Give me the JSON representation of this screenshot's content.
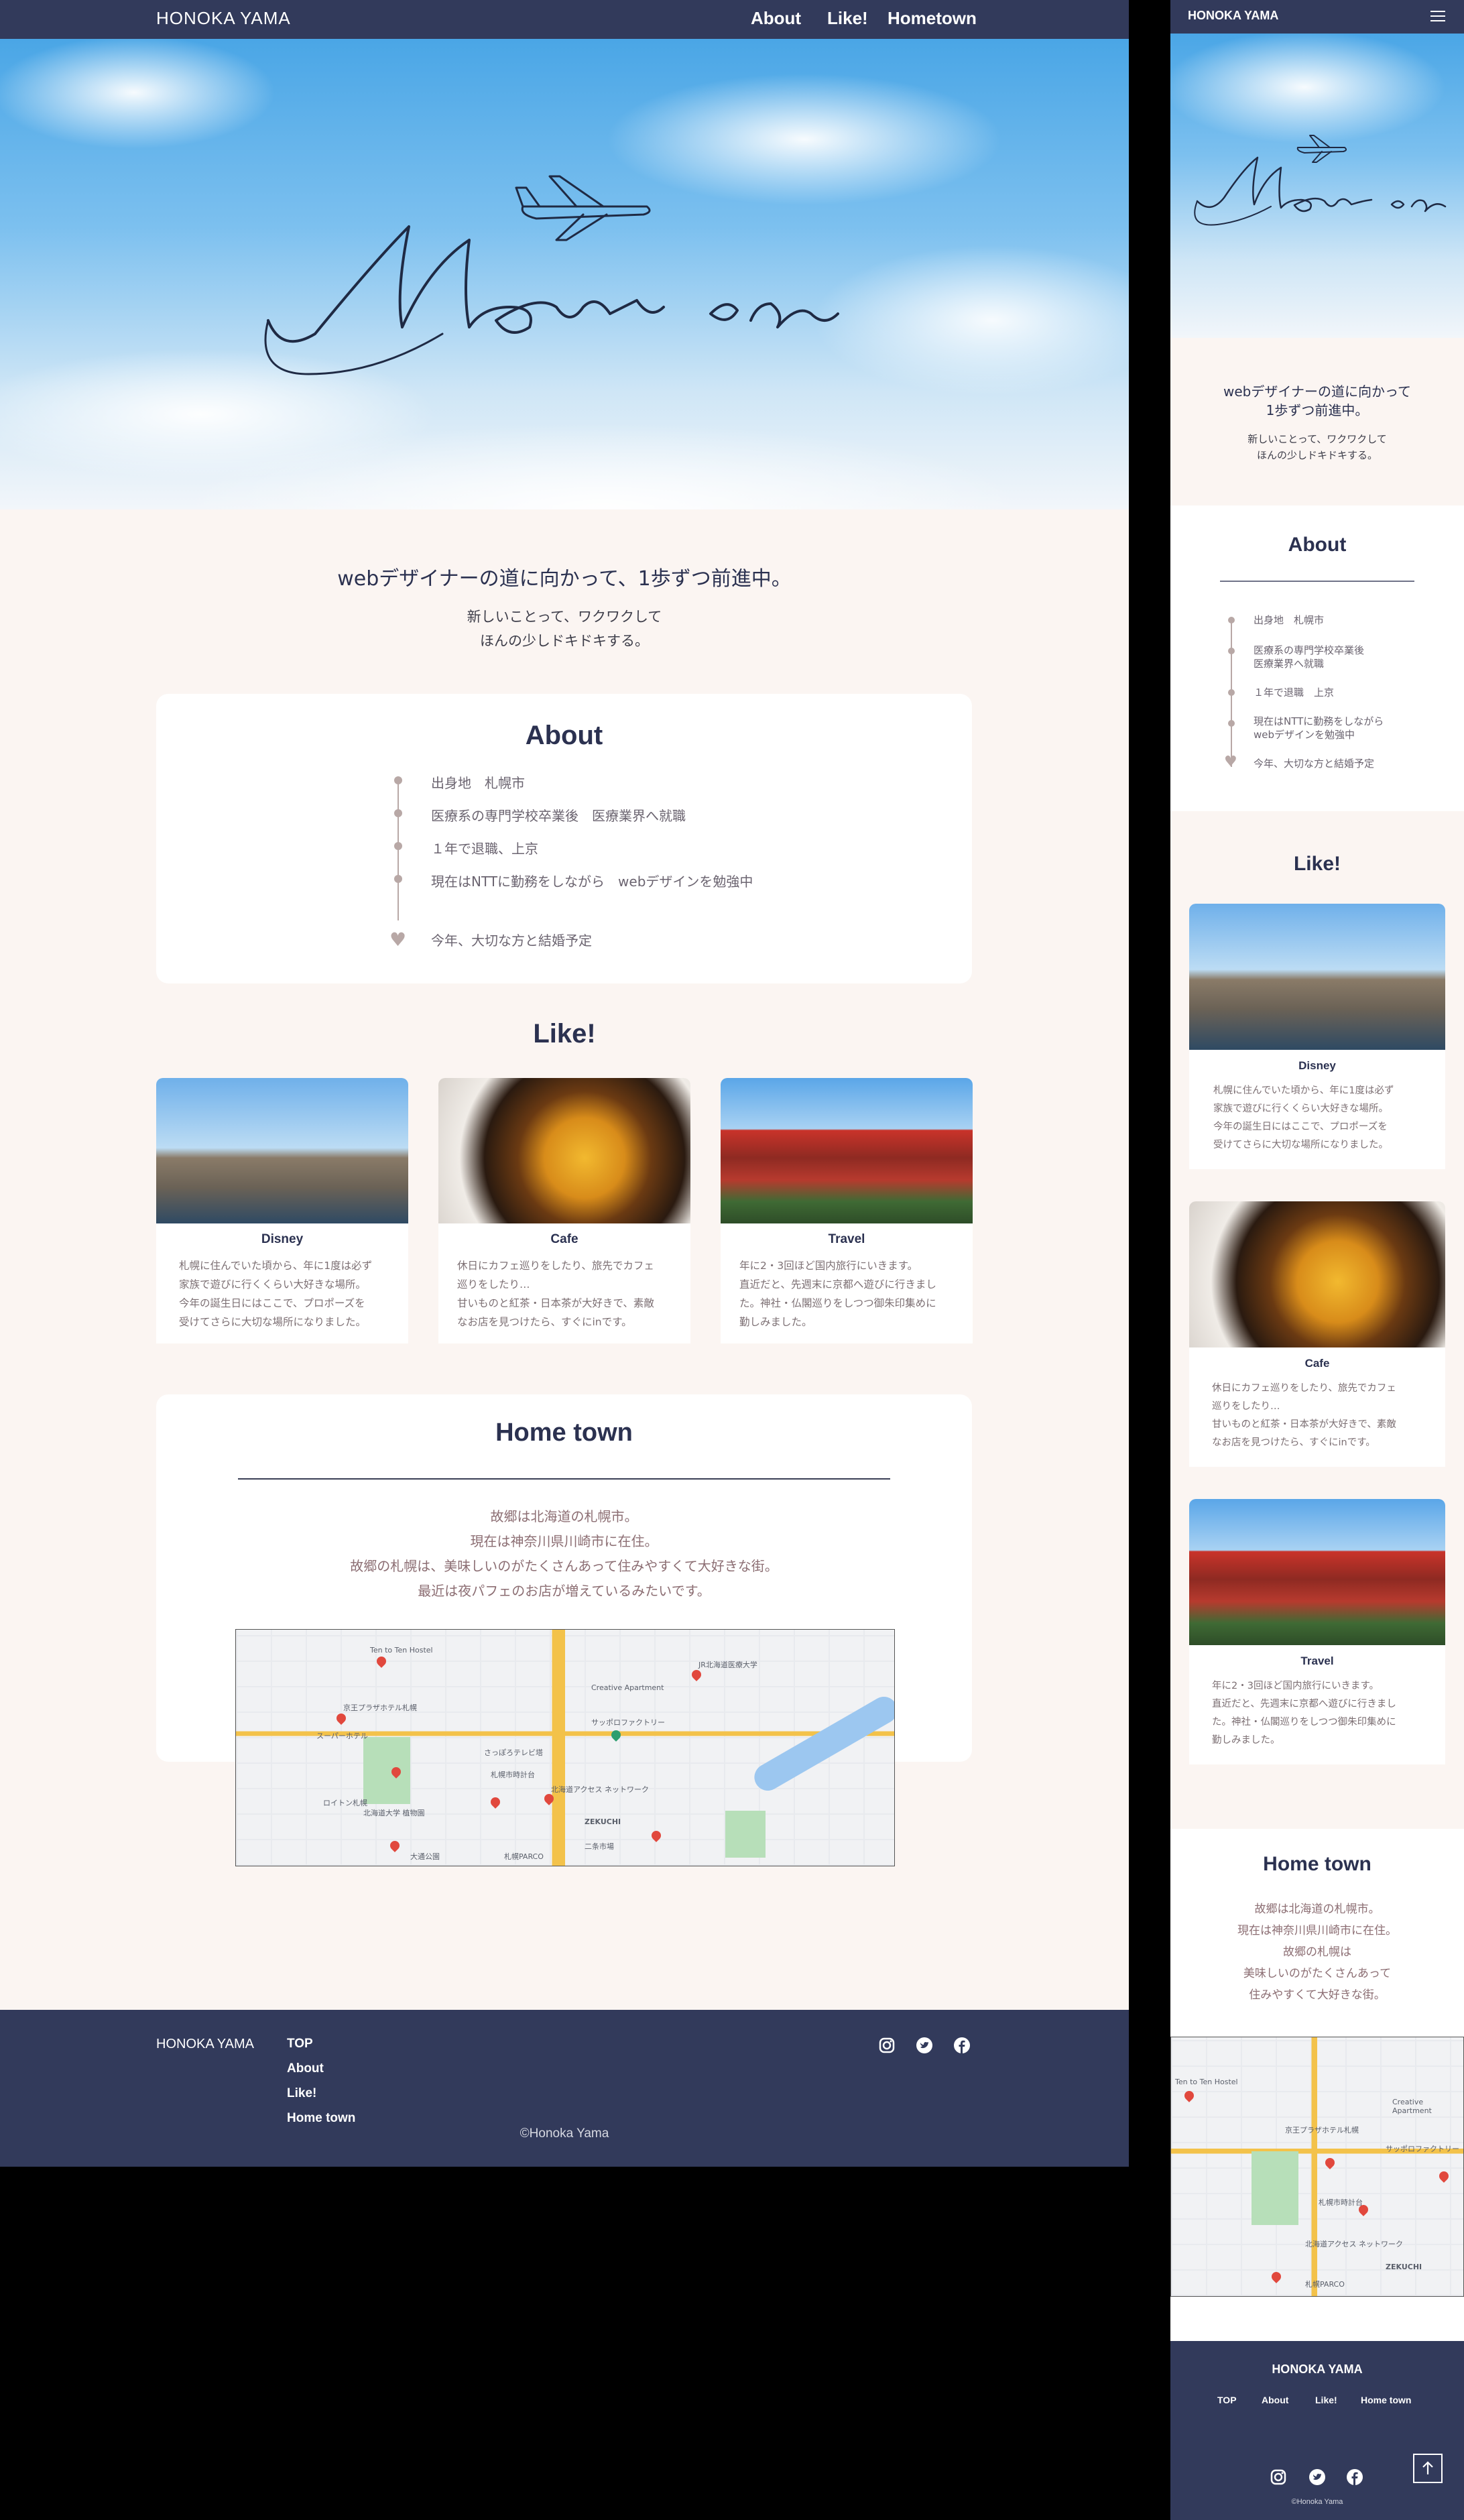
{
  "site": {
    "brand": "HONOKA YAMA",
    "hero_script": "Move on"
  },
  "nav": {
    "items": [
      "About",
      "Like!",
      "Hometown"
    ]
  },
  "intro": {
    "headline": "webデザイナーの道に向かって、1歩ずつ前進中。",
    "sub_line1": "新しいことって、ワクワクして",
    "sub_line2": "ほんの少しドキドキする。"
  },
  "mobile_intro": {
    "headline_line1": "webデザイナーの道に向かって",
    "headline_line2": "1歩ずつ前進中。",
    "sub_line1": "新しいことって、ワクワクして",
    "sub_line2": "ほんの少しドキドキする。"
  },
  "about": {
    "title": "About",
    "timeline": [
      "出身地　札幌市",
      "医療系の専門学校卒業後　医療業界へ就職",
      "１年で退職、上京",
      "現在はNTTに勤務をしながら　webデザインを勉強中",
      "今年、大切な方と結婚予定"
    ],
    "mobile_timeline": [
      "出身地　札幌市",
      "医療系の専門学校卒業後\n医療業界へ就職",
      "１年で退職　上京",
      "現在はNTTに勤務をしながら\nwebデザインを勉強中",
      "今年、大切な方と結婚予定"
    ]
  },
  "like": {
    "title": "Like!",
    "cards": [
      {
        "title": "Disney",
        "text": "札幌に住んでいた頃から、年に1度は必ず\n家族で遊びに行くくらい大好きな場所。\n今年の誕生日にはここで、プロポーズを\n受けてさらに大切な場所になりました。"
      },
      {
        "title": "Cafe",
        "text": "休日にカフェ巡りをしたり、旅先でカフェ\n巡りをしたり…\n甘いものと紅茶・日本茶が大好きで、素敵\nなお店を見つけたら、すぐにinです。"
      },
      {
        "title": "Travel",
        "text": "年に2・3回ほど国内旅行にいきます。\n直近だと、先週末に京都へ遊びに行きまし\nた。神社・仏閣巡りをしつつ御朱印集めに\n勤しみました。"
      }
    ]
  },
  "hometown": {
    "title": "Home town",
    "text": "故郷は北海道の札幌市。\n現在は神奈川県川崎市に在住。\n故郷の札幌は、美味しいのがたくさんあって住みやすくて大好きな街。\n最近は夜パフェのお店が増えているみたいです。",
    "mobile_text": "故郷は北海道の札幌市。\n現在は神奈川県川崎市に在住。\n故郷の札幌は\n美味しいのがたくさんあって\n住みやすくて大好きな街。",
    "map_labels": [
      "Ten to Ten Hostel",
      "京王プラザホテル札幌",
      "JR北海道医療大学",
      "Creative Apartment",
      "サッポロファクトリー",
      "スーパーホテル",
      "北海道大学 植物園",
      "さっぽろテレビ塔",
      "札幌市時計台",
      "ロイトン札幌",
      "北海道アクセス ネットワーク",
      "ZEKUCHI",
      "二条市場",
      "札幌PARCO",
      "大通公園"
    ]
  },
  "footer": {
    "brand": "HONOKA YAMA",
    "links": [
      "TOP",
      "About",
      "Like!",
      "Home town"
    ],
    "copyright": "©Honoka Yama",
    "social_icons": [
      "instagram-icon",
      "twitter-icon",
      "facebook-icon"
    ]
  },
  "colors": {
    "navy": "#323a5b",
    "cream": "#fbf5f2",
    "accent_grey": "#b8a8a6",
    "text_navy": "#2b3150"
  }
}
